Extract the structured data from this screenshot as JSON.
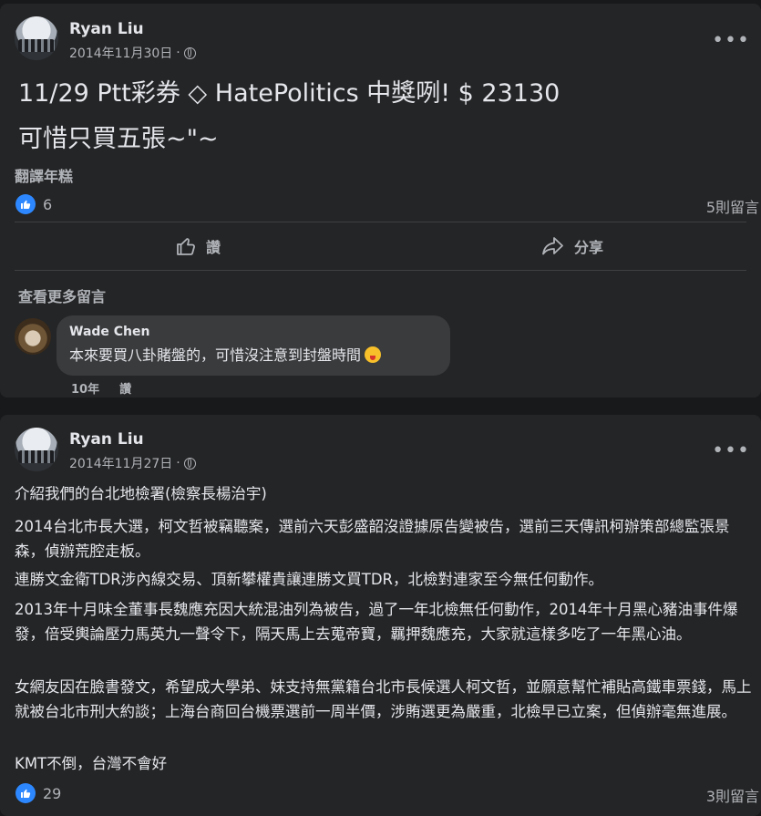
{
  "post1": {
    "author": "Ryan Liu",
    "date": "2014年11月30日",
    "dot": "·",
    "more": "•••",
    "line1": "11/29 Ptt彩券 ◇ HatePolitics 中獎咧! $ 23130",
    "line2": "可惜只買五張~\"~",
    "translate": "翻譯年糕",
    "likes": "6",
    "comments": "5則留言",
    "like_label": "讚",
    "share_label": "分享",
    "view_more": "查看更多留言",
    "comment": {
      "name": "Wade Chen",
      "text": "本來要買八卦賭盤的，可惜沒注意到封盤時間",
      "age": "10年",
      "like": "讚"
    }
  },
  "post2": {
    "author": "Ryan Liu",
    "date": "2014年11月27日",
    "dot": "·",
    "more": "•••",
    "paragraphs": [
      "介紹我們的台北地檢署(檢察長楊治宇)",
      "2014台北市長大選，柯文哲被竊聽案，選前六天彭盛韶沒證據原告變被告，選前三天傳訊柯辦策部總監張景森，偵辦荒腔走板。",
      "連勝文金衛TDR涉內線交易、頂新攀權貴讓連勝文買TDR，北檢對連家至今無任何動作。",
      "2013年十月味全董事長魏應充因大統混油列為被告，過了一年北檢無任何動作，2014年十月黑心豬油事件爆發，倍受輿論壓力馬英九一聲令下，隔天馬上去蒐帝寶，羈押魏應充，大家就這樣多吃了一年黑心油。",
      "女網友因在臉書發文，希望成大學弟、妹支持無黨籍台北市長候選人柯文哲，並願意幫忙補貼高鐵車票錢，馬上就被台北市刑大約談；上海台商回台機票選前一周半價，涉賄選更為嚴重，北檢早已立案，但偵辦毫無進展。",
      "KMT不倒，台灣不會好"
    ],
    "likes": "29",
    "comments": "3則留言"
  },
  "colors": {
    "bg": "#18191a",
    "card": "#242526",
    "accent": "#2d88ff",
    "secondary_text": "#b0b3b8"
  }
}
